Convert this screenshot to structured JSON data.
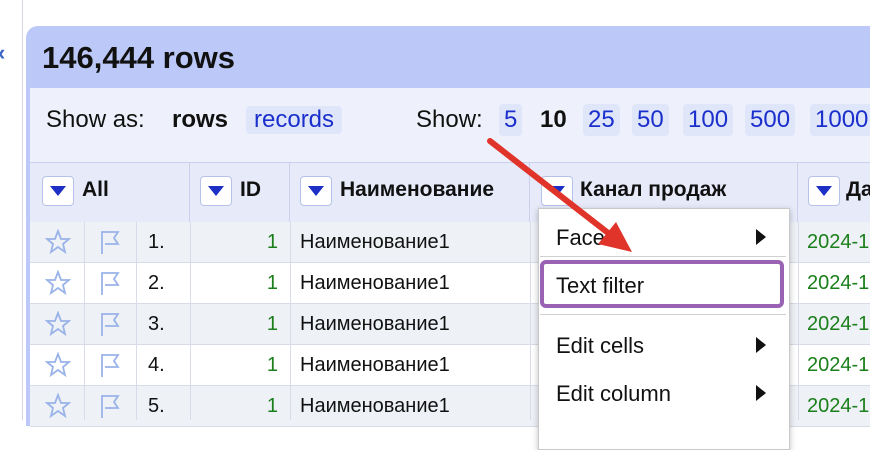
{
  "header": {
    "row_count": "146,444 rows"
  },
  "view": {
    "show_as_label": "Show as:",
    "rows_option": "rows",
    "records_option": "records",
    "show_label": "Show:",
    "page_sizes": [
      "5",
      "10",
      "25",
      "50",
      "100",
      "500",
      "1000"
    ],
    "selected_page_size": "10"
  },
  "columns": [
    "All",
    "ID",
    "Наименование",
    "Канал продаж",
    "Да"
  ],
  "rows": [
    {
      "num": "1.",
      "id": "1",
      "name": "Наименование1",
      "date": "2024-1"
    },
    {
      "num": "2.",
      "id": "1",
      "name": "Наименование1",
      "date": "2024-1"
    },
    {
      "num": "3.",
      "id": "1",
      "name": "Наименование1",
      "date": "2024-1"
    },
    {
      "num": "4.",
      "id": "1",
      "name": "Наименование1",
      "date": "2024-1"
    },
    {
      "num": "5.",
      "id": "1",
      "name": "Наименование1",
      "date": "2024-1"
    }
  ],
  "menu": {
    "facet": "Facet",
    "text_filter": "Text filter",
    "edit_cells": "Edit cells",
    "edit_column": "Edit column"
  },
  "colors": {
    "accent": "#1a2fcc",
    "highlight": "#9a62b3",
    "annotation_arrow": "#e0342b",
    "value_green": "#1a7f1a"
  },
  "icons": [
    "close-icon",
    "star-icon",
    "flag-icon",
    "dropdown-arrow-icon",
    "submenu-arrow-icon"
  ]
}
